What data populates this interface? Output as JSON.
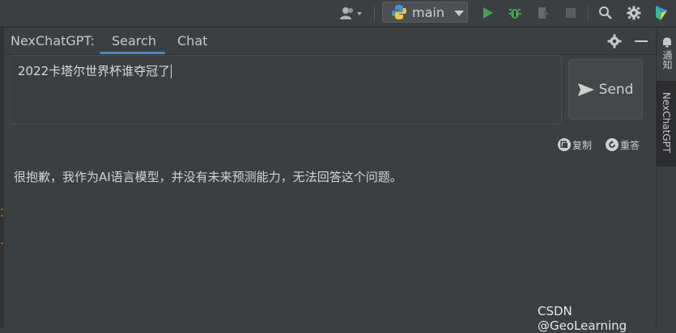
{
  "toolbar": {
    "run_config": "main",
    "icons": [
      "user-icon",
      "python-icon",
      "run-icon",
      "debug-icon",
      "profile-icon",
      "stop-icon",
      "search-icon",
      "settings-icon",
      "plugin-icon"
    ]
  },
  "tool_window": {
    "title": "NexChatGPT:",
    "tabs": [
      {
        "label": "Search",
        "active": true
      },
      {
        "label": "Chat",
        "active": false
      }
    ]
  },
  "query": {
    "text": "2022卡塔尔世界杯谁夺冠了"
  },
  "send_label": "Send",
  "actions": {
    "copy_label": "复制",
    "regenerate_label": "重答"
  },
  "answer": "很抱歉，我作为AI语言模型，并没有未来预测能力，无法回答这个问题。",
  "right_stripe": {
    "notifications_label": "通知",
    "plugin_label": "NexChatGPT"
  },
  "watermark": "CSDN @GeoLearning",
  "colors": {
    "background": "#3c3f41",
    "accent": "#4a88c7",
    "run_green": "#499c54"
  }
}
